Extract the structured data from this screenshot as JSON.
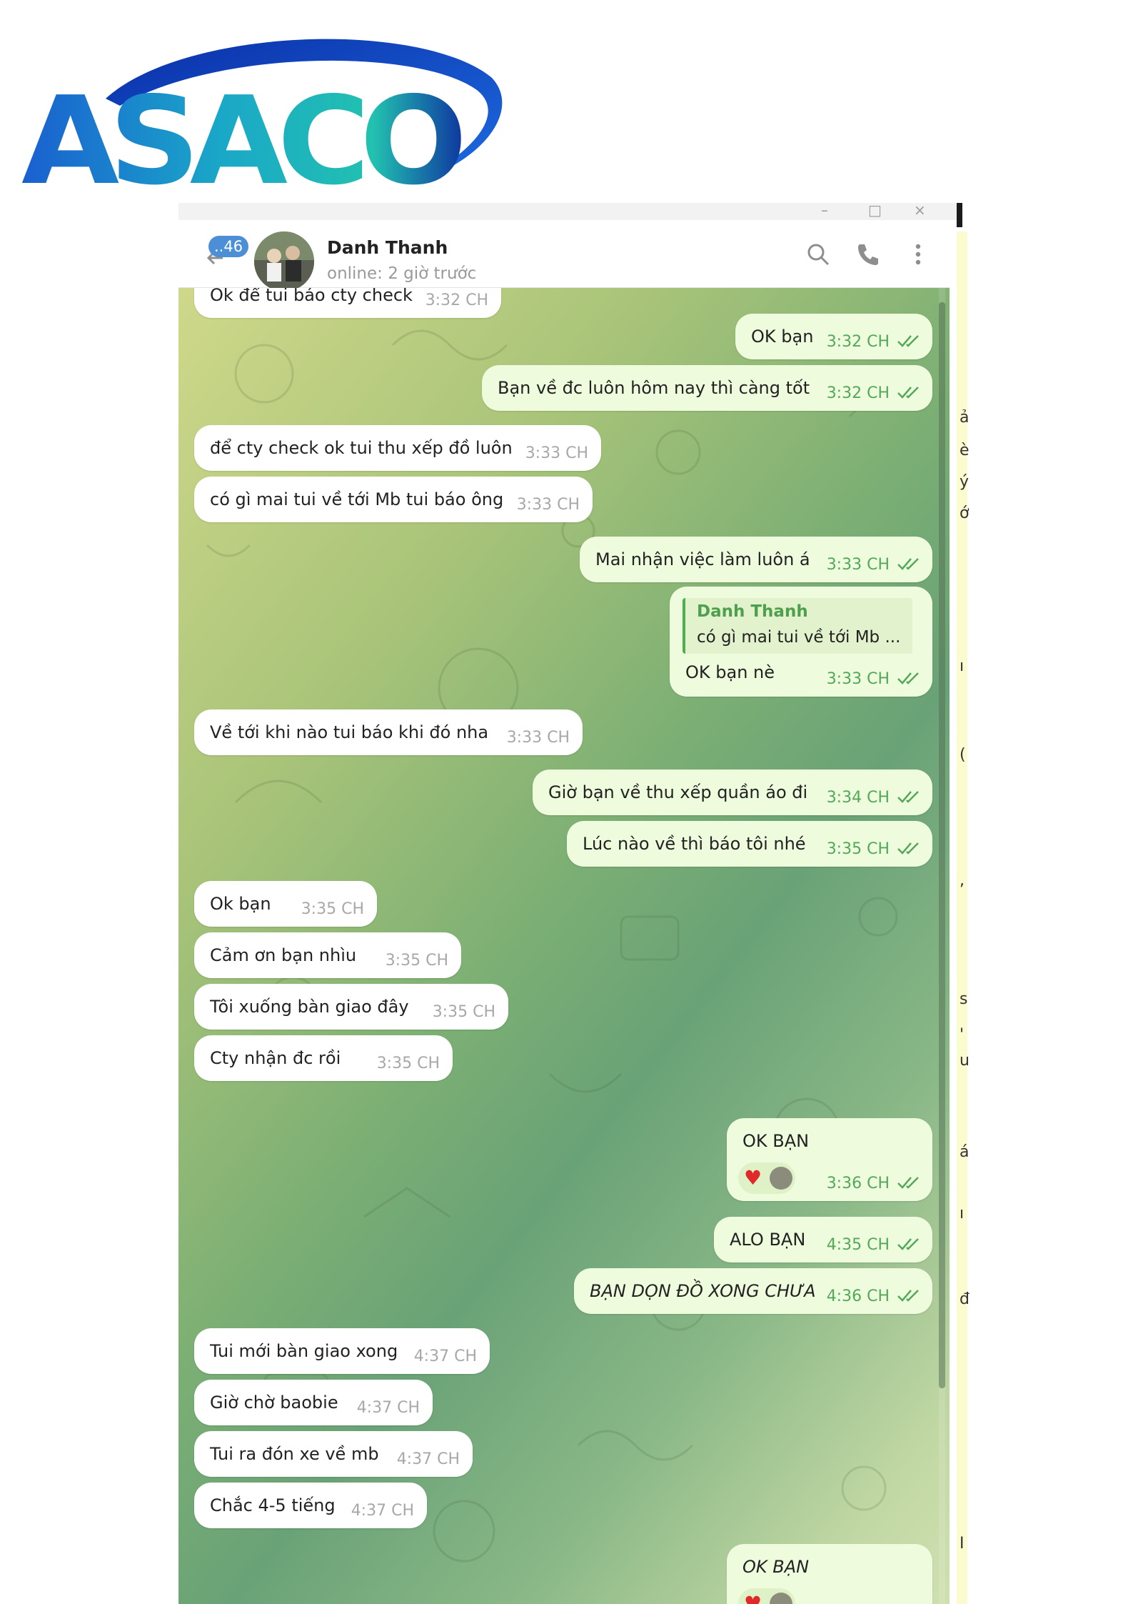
{
  "logo": {
    "text": "ASACO"
  },
  "header": {
    "unread_count": "..46",
    "contact_name": "Danh Thanh",
    "contact_status": "online: 2 giờ trước",
    "icons": [
      "back-arrow-icon",
      "search-icon",
      "phone-icon",
      "more-vertical-icon"
    ]
  },
  "messages": [
    {
      "dir": "in",
      "text": "Ok để tui báo cty check",
      "time": "3:32 CH"
    },
    {
      "dir": "out",
      "text": "OK bạn",
      "time": "3:32 CH"
    },
    {
      "dir": "out",
      "text": "Bạn về đc luôn hôm nay thì càng tốt",
      "time": "3:32 CH"
    },
    {
      "dir": "in",
      "text": "để cty check ok tui thu xếp đồ luôn",
      "time": "3:33 CH"
    },
    {
      "dir": "in",
      "text": "có gì mai tui về tới Mb tui báo ông",
      "time": "3:33 CH"
    },
    {
      "dir": "out",
      "text": "Mai nhận việc làm luôn á",
      "time": "3:33 CH"
    },
    {
      "dir": "out",
      "reply_to_name": "Danh Thanh",
      "reply_to_text": "có gì mai tui về tới Mb ...",
      "text": "OK bạn nè",
      "time": "3:33 CH"
    },
    {
      "dir": "in",
      "text": "Về tới khi nào tui báo khi đó nha",
      "time": "3:33 CH"
    },
    {
      "dir": "out",
      "text": "Giờ bạn về thu xếp quần áo đi",
      "time": "3:34 CH"
    },
    {
      "dir": "out",
      "text": "Lúc nào về thì báo tôi nhé",
      "time": "3:35 CH"
    },
    {
      "dir": "in",
      "text": "Ok bạn",
      "time": "3:35 CH"
    },
    {
      "dir": "in",
      "text": "Cảm ơn bạn nhìu",
      "time": "3:35 CH"
    },
    {
      "dir": "in",
      "text": "Tôi xuống bàn giao đây",
      "time": "3:35 CH"
    },
    {
      "dir": "in",
      "text": "Cty nhận đc rồi",
      "time": "3:35 CH"
    },
    {
      "dir": "out",
      "text": "OK BẠN",
      "time": "3:36 CH",
      "reaction": "heart-icon"
    },
    {
      "dir": "out",
      "text": "ALO BẠN",
      "time": "4:35 CH"
    },
    {
      "dir": "out",
      "text": "BẠN DỌN ĐỒ XONG CHƯA",
      "time": "4:36 CH",
      "italic": true
    },
    {
      "dir": "in",
      "text": "Tui mới bàn giao xong",
      "time": "4:37 CH"
    },
    {
      "dir": "in",
      "text": "Giờ chờ baobie",
      "time": "4:37 CH"
    },
    {
      "dir": "in",
      "text": "Tui ra đón xe về mb",
      "time": "4:37 CH"
    },
    {
      "dir": "in",
      "text": "Chắc 4-5 tiếng",
      "time": "4:37 CH"
    },
    {
      "dir": "out",
      "text": "OK BẠN",
      "italic": true,
      "reaction": "heart-icon"
    }
  ],
  "colors": {
    "incoming_bubble": "#ffffff",
    "outgoing_bubble": "#eefbdc",
    "outgoing_time": "#54a85c",
    "accent": "#4c8fd6",
    "reply_name": "#4ea04e"
  },
  "edge_fragments": [
    "ả",
    "è",
    "ý",
    "ớ",
    "ı",
    "(",
    ",",
    "s",
    "'",
    "u",
    "á",
    "ı",
    "đ",
    "I"
  ]
}
